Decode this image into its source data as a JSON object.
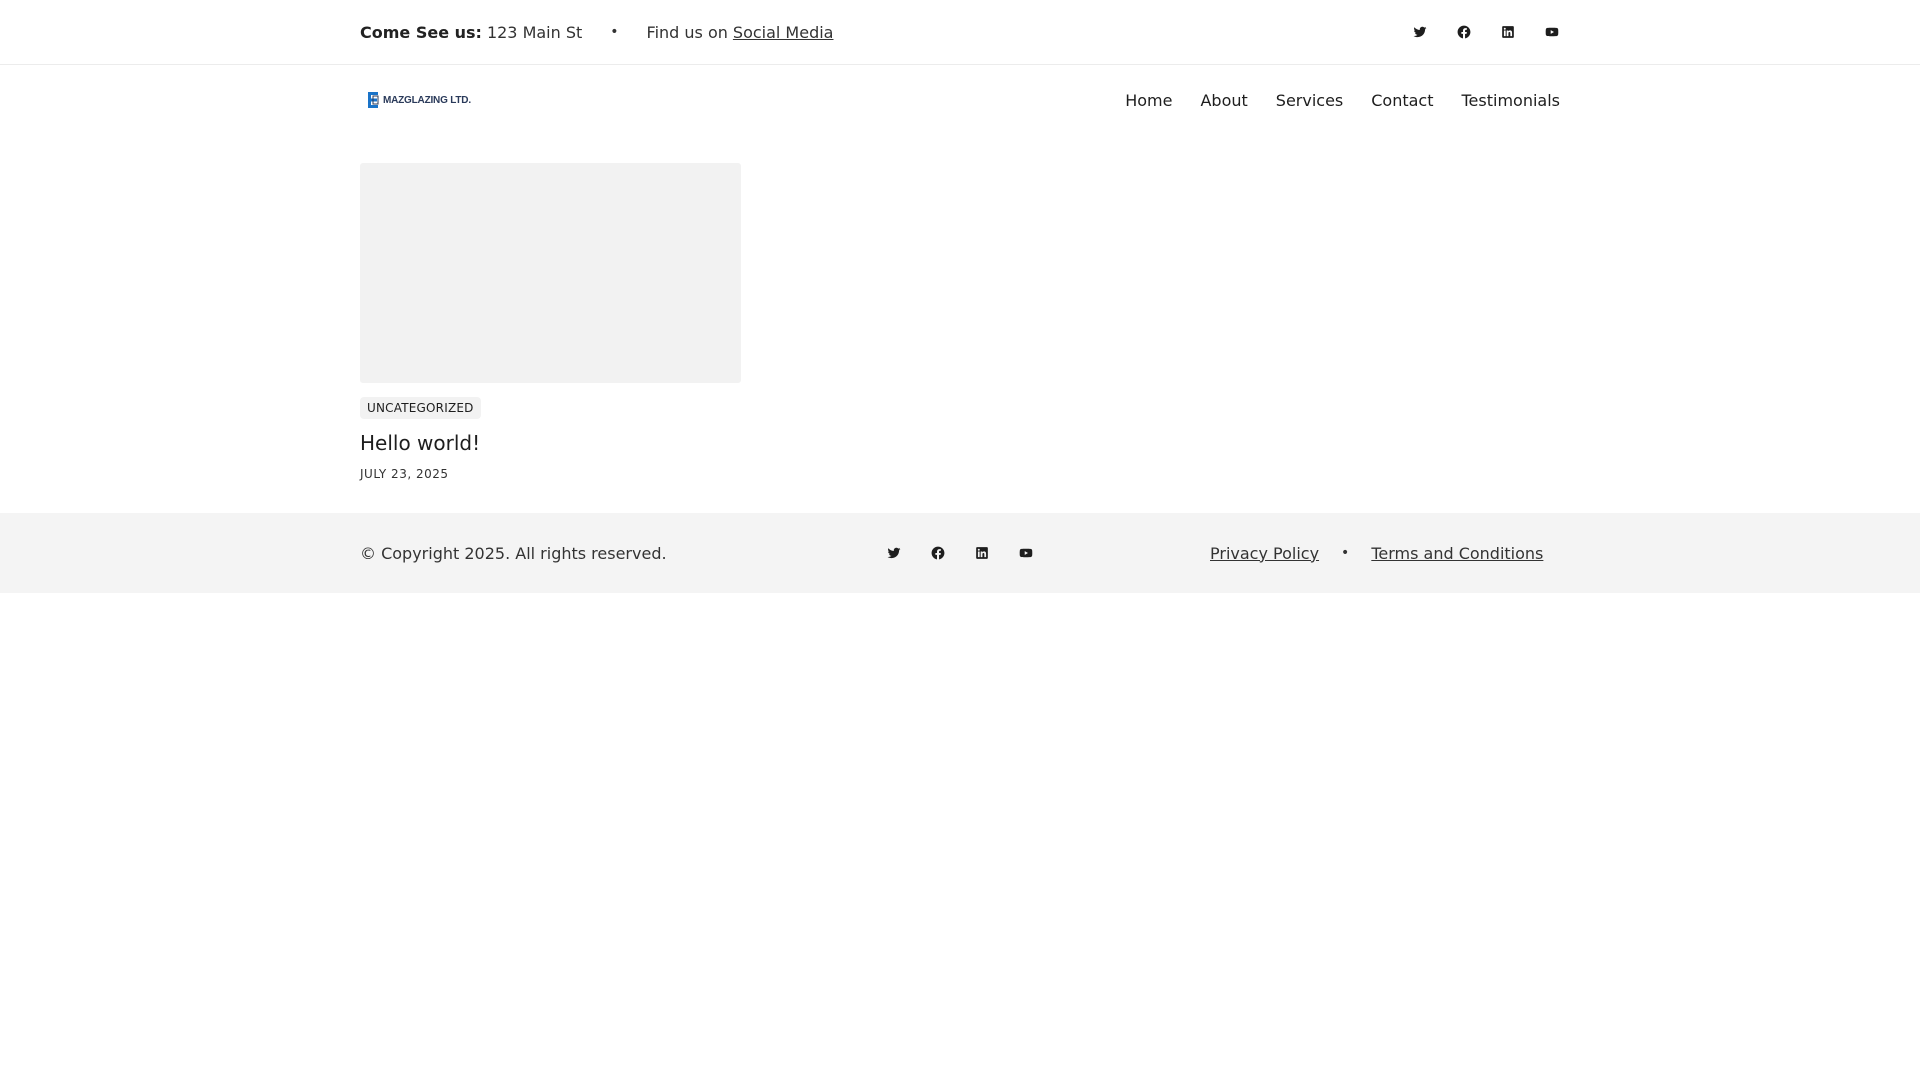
{
  "topbar": {
    "visit_label": "Come See us:",
    "address": "123 Main St",
    "separator": "•",
    "find_text": "Find us on",
    "social_link": "Social Media",
    "icons": [
      "twitter-icon",
      "facebook-icon",
      "linkedin-icon",
      "youtube-icon"
    ]
  },
  "header": {
    "logo_text": "MAZGLAZING LTD.",
    "nav": [
      "Home",
      "About",
      "Services",
      "Contact",
      "Testimonials"
    ]
  },
  "posts": [
    {
      "category": "UNCATEGORIZED",
      "title": "Hello world!",
      "date": "JULY 23, 2025"
    }
  ],
  "footer": {
    "copyright": "© Copyright 2025. All rights reserved.",
    "icons": [
      "twitter-icon",
      "facebook-icon",
      "linkedin-icon",
      "youtube-icon"
    ],
    "privacy": "Privacy Policy",
    "separator": "•",
    "terms": "Terms and Conditions"
  },
  "colors": {
    "text": "#1e1e1e",
    "card_placeholder": "#f2f2f2",
    "footer_bg": "#f4f4f4",
    "logo_blue": "#1a73c8"
  }
}
